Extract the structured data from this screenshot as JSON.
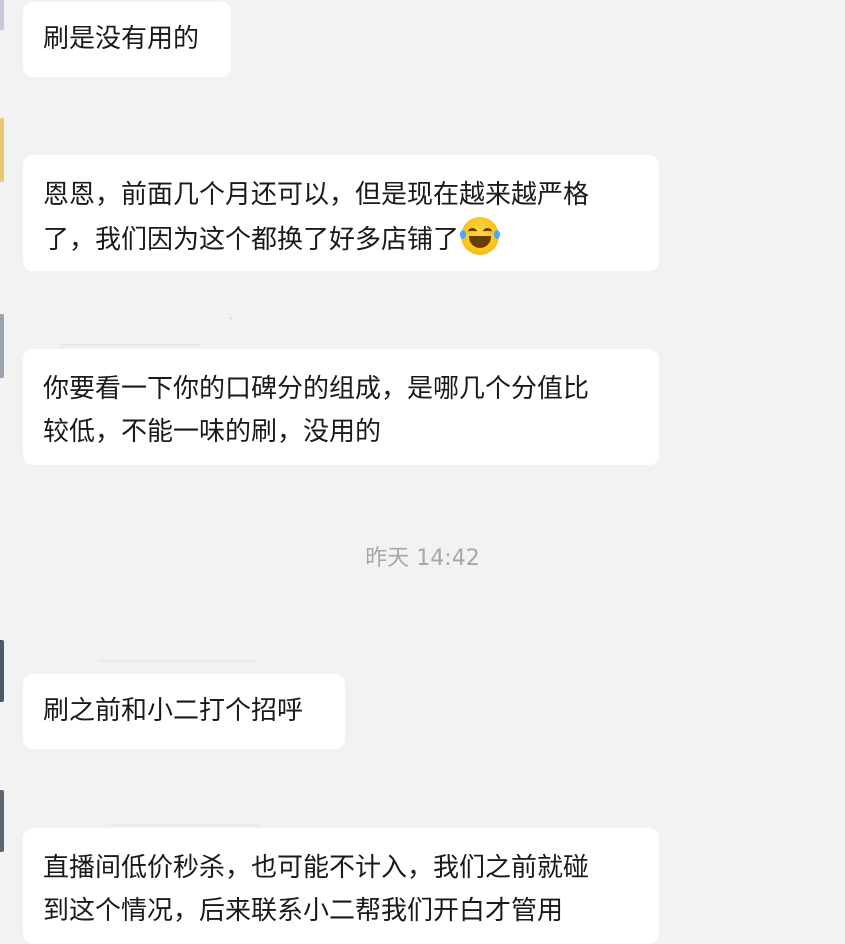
{
  "chat": {
    "messages": [
      {
        "lines": [
          "刷是没有用的"
        ]
      },
      {
        "lines": [
          "恩恩，前面几个月还可以，但是现在越来越严格",
          "了，我们因为这个都换了好多店铺了"
        ],
        "emoji": "face-with-tears-of-joy-icon"
      },
      {
        "lines": [
          "你要看一下你的口碑分的组成，是哪几个分值比",
          "较低，不能一味的刷，没用的"
        ]
      },
      {
        "lines": [
          "刷之前和小二打个招呼"
        ]
      },
      {
        "lines": [
          "直播间低价秒杀，也可能不计入，我们之前就碰",
          "到这个情况，后来联系小二帮我们开白才管用"
        ]
      }
    ],
    "timestamp": "昨天 14:42"
  },
  "colors": {
    "background": "#f2f2f2",
    "bubble": "#ffffff",
    "text": "#1a1a1a",
    "timestamp": "#a7a7a7"
  }
}
